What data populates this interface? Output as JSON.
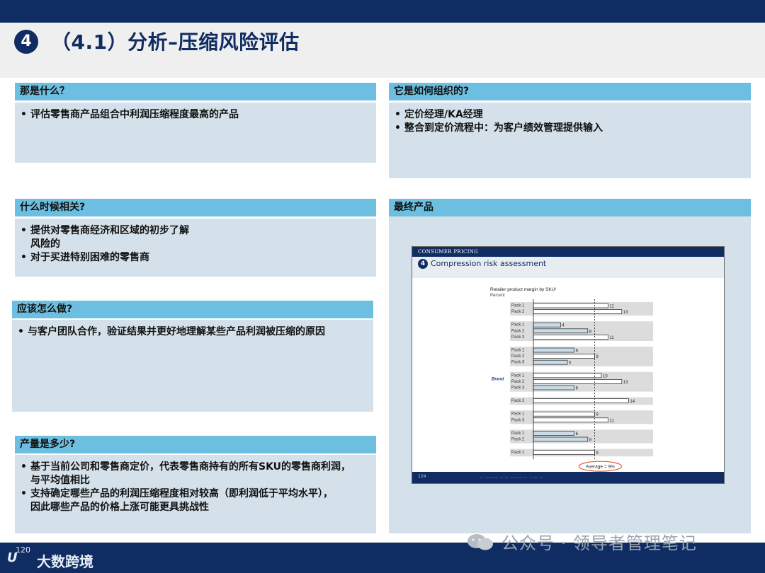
{
  "header": {
    "number": "4",
    "title": "（4.1）分析–压缩风险评估"
  },
  "sections": {
    "what": {
      "heading": "那是什么？",
      "bullets": [
        "评估零售商产品组合中利润压缩程度最高的产品"
      ]
    },
    "how_organized": {
      "heading": "它是如何组织的?",
      "bullets": [
        "定价经理/KA经理",
        "整合到定价流程中：为客户绩效管理提供输入"
      ]
    },
    "when": {
      "heading": "什么时候相关?",
      "bullets": [
        "提供对零售商经济和区域的初步了解\n风险的",
        "对于买进特别困难的零售商"
      ]
    },
    "how_to": {
      "heading": "应该怎么做?",
      "bullets": [
        "与客户团队合作，验证结果并更好地理解某些产品利润被压缩的原因"
      ]
    },
    "volume": {
      "heading": "产量是多少?",
      "bullets": [
        "基于当前公司和零售商定价，代表零售商持有的所有SKU的零售商利润，\n与平均值相比",
        "支持确定哪些产品的利润压缩程度相对较高（即利润低于平均水平），\n因此哪些产品的价格上涨可能更具挑战性"
      ]
    },
    "final": {
      "heading": "最终产品"
    }
  },
  "embedded_slide": {
    "top_label": "CONSUMER PRICING",
    "number": "4",
    "title": "Compression risk assessment",
    "page": "124",
    "footer_text": "— ——— —— ———— —— —"
  },
  "chart_data": {
    "type": "bar",
    "title": "Retailer product margin by SKU¹",
    "subtitle": "Percent",
    "group_label": "Brand",
    "average_label": "Average = 9%",
    "average": 9,
    "xlim": [
      0,
      16
    ],
    "groups": [
      {
        "items": [
          {
            "label": "Pack 1",
            "value": 11
          },
          {
            "label": "Pack 2",
            "value": 13
          }
        ]
      },
      {
        "items": [
          {
            "label": "Pack 1",
            "value": 4
          },
          {
            "label": "Pack 2",
            "value": 8
          },
          {
            "label": "Pack 3",
            "value": 11
          }
        ]
      },
      {
        "items": [
          {
            "label": "Pack 1",
            "value": 6
          },
          {
            "label": "Pack 2",
            "value": 9
          },
          {
            "label": "Pack 3",
            "value": 5
          }
        ]
      },
      {
        "items": [
          {
            "label": "Pack 1",
            "value": 10
          },
          {
            "label": "Pack 2",
            "value": 13
          },
          {
            "label": "Pack 3",
            "value": 6
          }
        ]
      },
      {
        "items": [
          {
            "label": "Pack 2",
            "value": 14
          }
        ]
      },
      {
        "items": [
          {
            "label": "Pack 1",
            "value": 9
          },
          {
            "label": "Pack 3",
            "value": 11
          }
        ]
      },
      {
        "items": [
          {
            "label": "Pack 1",
            "value": 6
          },
          {
            "label": "Pack 2",
            "value": 8
          }
        ]
      },
      {
        "items": [
          {
            "label": "Pack 1",
            "value": 9
          }
        ]
      }
    ]
  },
  "footer": {
    "logo": "U",
    "brand": "大数跨境",
    "page": "120"
  },
  "watermark": "公众号 · 领导者管理笔记"
}
